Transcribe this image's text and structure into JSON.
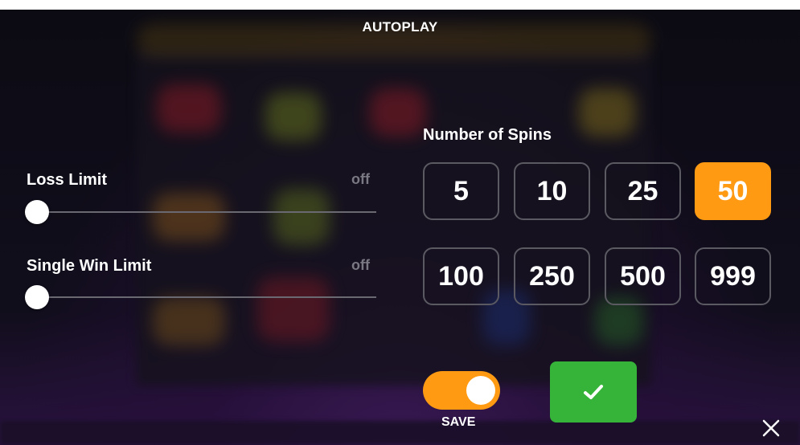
{
  "title": "AUTOPLAY",
  "loss_limit": {
    "label": "Loss Limit",
    "value": "off",
    "level": 0
  },
  "single_win_limit": {
    "label": "Single Win Limit",
    "value": "off",
    "level": 0
  },
  "spins": {
    "label": "Number of Spins",
    "options": [
      "5",
      "10",
      "25",
      "50",
      "100",
      "250",
      "500",
      "999"
    ],
    "selected": "50"
  },
  "save": {
    "label": "SAVE",
    "enabled": true
  },
  "colors": {
    "accent": "#ff9a12",
    "confirm": "#36b43a"
  },
  "icons": {
    "confirm": "checkmark-icon",
    "close": "close-icon"
  }
}
